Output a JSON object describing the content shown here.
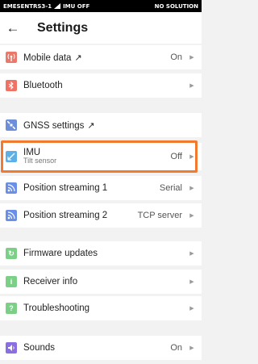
{
  "status": {
    "left": "EMESENTRS3-1",
    "imu": "IMU OFF",
    "right": "NO SOLUTION"
  },
  "header": {
    "title": "Settings"
  },
  "items": {
    "mobile": {
      "label": "Mobile data",
      "ext": "↗",
      "value": "On",
      "color": "#e97a6b"
    },
    "bluetooth": {
      "label": "Bluetooth",
      "value": "",
      "color": "#ef7264"
    },
    "gnss": {
      "label": "GNSS settings",
      "ext": "↗",
      "color": "#6d8fd9"
    },
    "imu": {
      "label": "IMU",
      "sub": "Tilt sensor",
      "value": "Off",
      "color": "#5cb0e6"
    },
    "pos1": {
      "label": "Position streaming 1",
      "value": "Serial",
      "color": "#6b8fe6"
    },
    "pos2": {
      "label": "Position streaming 2",
      "value": "TCP server",
      "color": "#6b8fe6"
    },
    "firmware": {
      "label": "Firmware updates",
      "color": "#7ccf87"
    },
    "receiver": {
      "label": "Receiver info",
      "color": "#7ccf87"
    },
    "trouble": {
      "label": "Troubleshooting",
      "color": "#7ccf87"
    },
    "sounds": {
      "label": "Sounds",
      "value": "On",
      "color": "#8b6fe0"
    }
  }
}
